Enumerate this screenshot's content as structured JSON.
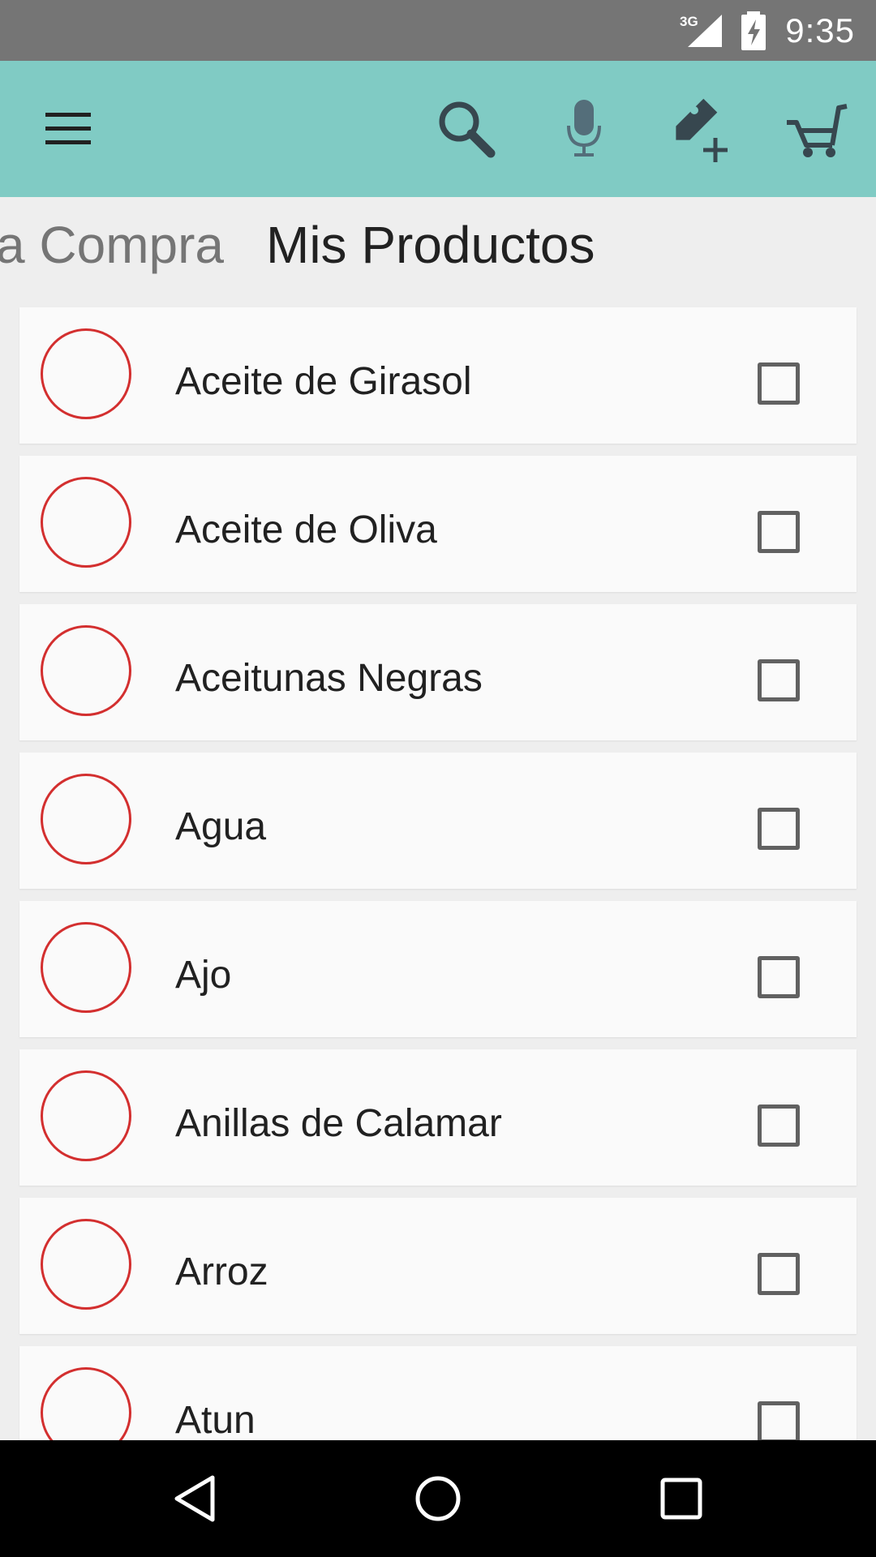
{
  "status_bar": {
    "network": "3G",
    "time": "9:35"
  },
  "toolbar": {
    "icons": {
      "menu": "hamburger-menu-icon",
      "search": "search-icon",
      "voice": "microphone-icon",
      "add_product": "tag-add-icon",
      "cart": "shopping-cart-icon"
    }
  },
  "tabs": [
    {
      "label": "a Compra",
      "active": false
    },
    {
      "label": "Mis Productos",
      "active": true
    }
  ],
  "products": [
    {
      "name": "Aceite de Girasol",
      "checked": false
    },
    {
      "name": "Aceite de Oliva",
      "checked": false
    },
    {
      "name": "Aceitunas Negras",
      "checked": false
    },
    {
      "name": "Agua",
      "checked": false
    },
    {
      "name": "Ajo",
      "checked": false
    },
    {
      "name": "Anillas de Calamar",
      "checked": false
    },
    {
      "name": "Arroz",
      "checked": false
    },
    {
      "name": "Atun",
      "checked": false
    }
  ],
  "colors": {
    "toolbar": "#80cbc4",
    "status_bar": "#757575",
    "circle_border": "#d32f2f",
    "icon_dark": "#37474f"
  }
}
